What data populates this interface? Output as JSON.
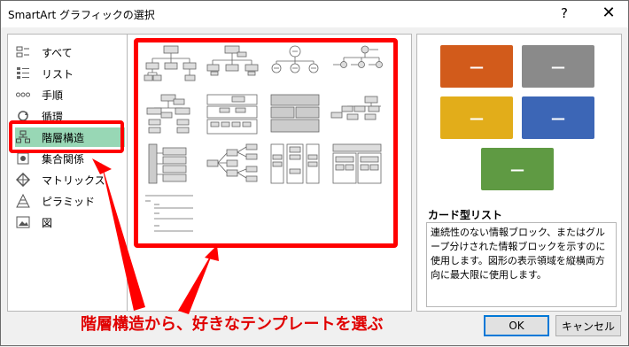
{
  "window": {
    "title": "SmartArt グラフィックの選択",
    "help": "?",
    "close": "✕"
  },
  "categories": [
    {
      "label": "すべて",
      "icon": "all-icon"
    },
    {
      "label": "リスト",
      "icon": "list-icon"
    },
    {
      "label": "手順",
      "icon": "process-icon"
    },
    {
      "label": "循環",
      "icon": "cycle-icon"
    },
    {
      "label": "階層構造",
      "icon": "hierarchy-icon",
      "selected": true
    },
    {
      "label": "集合関係",
      "icon": "relationship-icon"
    },
    {
      "label": "マトリックス",
      "icon": "matrix-icon"
    },
    {
      "label": "ピラミッド",
      "icon": "pyramid-icon"
    },
    {
      "label": "図",
      "icon": "picture-icon"
    }
  ],
  "preview": {
    "boxes": [
      {
        "color": "#d25b1b",
        "label": "—"
      },
      {
        "color": "#8a8a8a",
        "label": "—"
      },
      {
        "color": "#e2ad1a",
        "label": "—"
      },
      {
        "color": "#3c66b6",
        "label": "—"
      },
      {
        "color": "#5f9a43",
        "label": "—"
      }
    ],
    "title": "カード型リスト",
    "description": "連続性のない情報ブロック、またはグループ分けされた情報ブロックを示すのに使用します。図形の表示領域を縦横両方向に最大限に使用します。"
  },
  "annotation": "階層構造から、好きなテンプレートを選ぶ",
  "buttons": {
    "ok": "OK",
    "cancel": "キャンセル"
  },
  "colors": {
    "highlight": "#ff0000",
    "selected": "#98d7b5"
  }
}
